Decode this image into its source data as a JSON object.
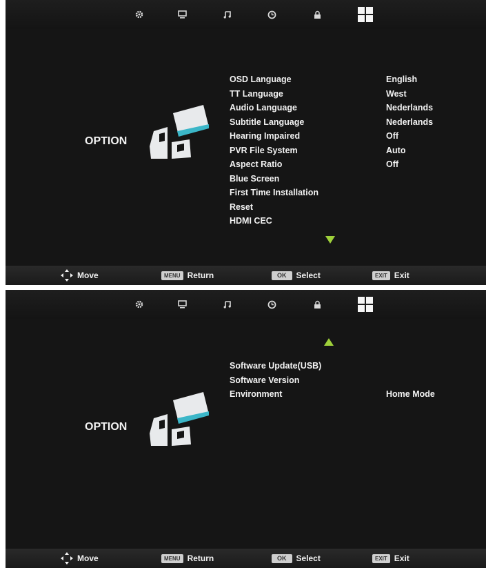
{
  "screens": [
    {
      "title": "OPTION",
      "items": [
        {
          "label": "OSD Language",
          "value": "English"
        },
        {
          "label": "TT Language",
          "value": "West"
        },
        {
          "label": "Audio Language",
          "value": "Nederlands"
        },
        {
          "label": "Subtitle Language",
          "value": "Nederlands"
        },
        {
          "label": "Hearing Impaired",
          "value": "Off"
        },
        {
          "label": "PVR File System",
          "value": "Auto"
        },
        {
          "label": "Aspect Ratio",
          "value": "Off"
        },
        {
          "label": "Blue Screen",
          "value": ""
        },
        {
          "label": "First Time Installation",
          "value": ""
        },
        {
          "label": "Reset",
          "value": ""
        },
        {
          "label": "HDMI CEC",
          "value": ""
        }
      ]
    },
    {
      "title": "OPTION",
      "items": [
        {
          "label": "Software Update(USB)",
          "value": ""
        },
        {
          "label": "Software Version",
          "value": ""
        },
        {
          "label": "Environment",
          "value": "Home Mode"
        }
      ]
    }
  ],
  "footer": {
    "move": "Move",
    "menu_key": "MENU",
    "return": "Return",
    "ok_key": "OK",
    "select": "Select",
    "exit_key": "EXIT",
    "exit": "Exit"
  },
  "tabs": [
    "picture-settings-icon",
    "display-icon",
    "sound-icon",
    "time-icon",
    "lock-icon",
    "option-icon"
  ],
  "colors": {
    "background": "#151515",
    "text": "#f2f2f2",
    "scroll_arrow": "#9ed03a",
    "logo_accent": "#3bb6c8"
  }
}
